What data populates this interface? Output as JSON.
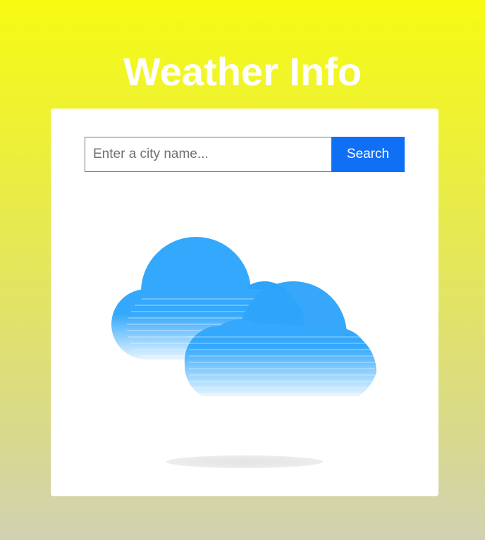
{
  "header": {
    "title": "Weather Info"
  },
  "search": {
    "placeholder": "Enter a city name...",
    "value": "",
    "button_label": "Search"
  },
  "weather": {
    "icon": "cloudy-icon"
  },
  "colors": {
    "accent": "#1070f5",
    "cloud": "#34a8fc",
    "background_top": "#f7fb12",
    "background_bottom": "#d1d1b3"
  }
}
